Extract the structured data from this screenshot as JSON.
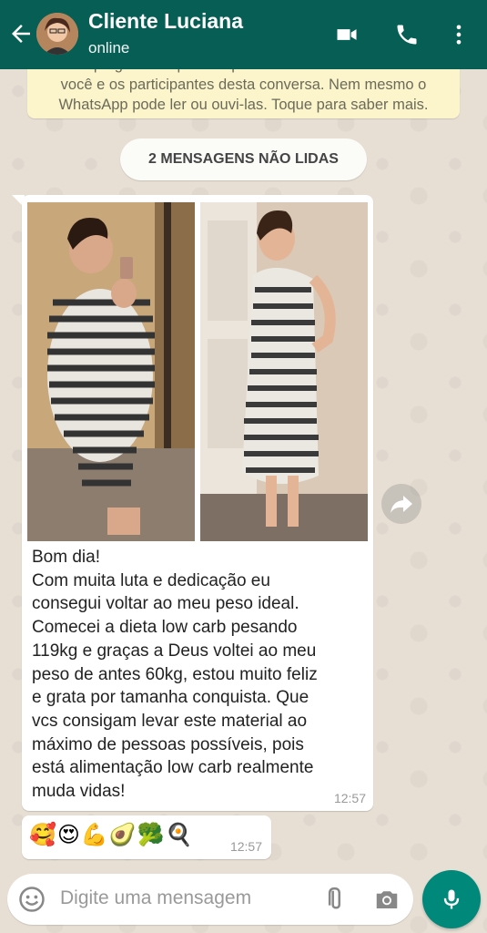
{
  "header": {
    "contact_name": "Cliente Luciana",
    "status": "online",
    "bg_color": "#075e54"
  },
  "encryption_notice": {
    "line1": "a criptografia de ponta a ponta e ficam somente entre",
    "line2": "você e os participantes desta conversa. Nem mesmo o",
    "line3": "WhatsApp pode ler ou ouvi-las. Toque para saber mais."
  },
  "unread_banner": "2 MENSAGENS NÃO LIDAS",
  "messages": [
    {
      "type": "image_with_caption",
      "text": "Bom dia!\nCom muita luta e dedicação eu\nconsegui voltar ao meu peso ideal.\nComecei a dieta low carb pesando\n119kg e graças a Deus voltei ao meu\npeso de antes 60kg, estou muito feliz\ne grata por tamanha conquista. Que\nvcs consigam levar este material ao\nmáximo de pessoas possíveis, pois\nestá alimentação low carb realmente\nmuda vidas!",
      "time": "12:57"
    },
    {
      "type": "emoji",
      "text": "🥰😍💪🥑🥦🍳",
      "time": "12:57"
    }
  ],
  "input": {
    "placeholder": "Digite uma mensagem"
  },
  "icons": {
    "back": "arrow-back-icon",
    "video": "video-call-icon",
    "call": "phone-icon",
    "menu": "more-vert-icon",
    "forward": "forward-icon",
    "emoji": "emoji-icon",
    "attach": "attach-icon",
    "camera": "camera-icon",
    "mic": "mic-icon"
  },
  "colors": {
    "accent": "#00897b",
    "bubble": "#ffffff",
    "notice": "#fcf4cb"
  }
}
